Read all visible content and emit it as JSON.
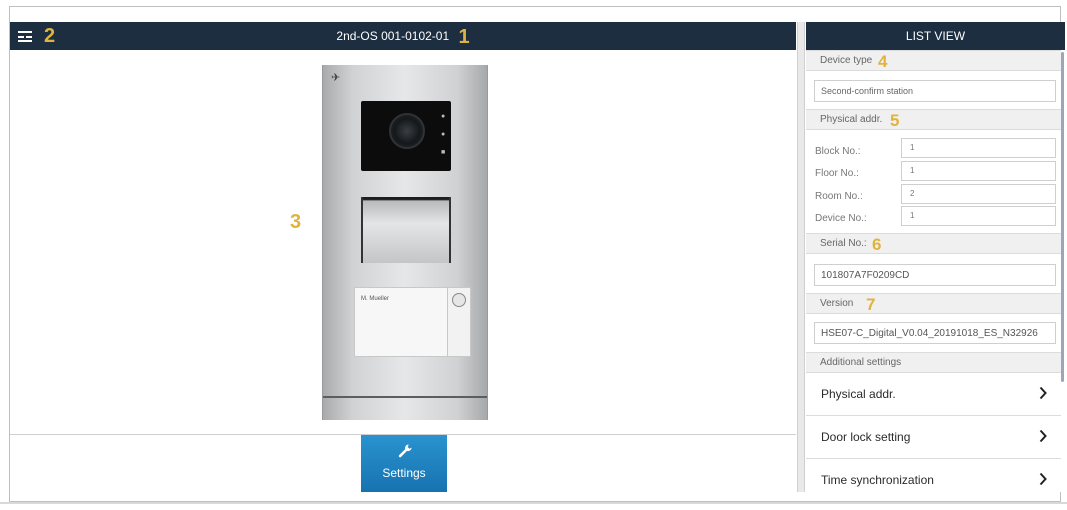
{
  "header": {
    "device_title": "2nd-OS 001-0102-01",
    "list_view_title": "LIST VIEW"
  },
  "callouts": {
    "c1": "1",
    "c2": "2",
    "c3": "3",
    "c4": "4",
    "c5": "5",
    "c6": "6",
    "c7": "7"
  },
  "device_preview": {
    "logo": "✈︎",
    "name_card": "M. Mueller"
  },
  "settings_button": {
    "label": "Settings",
    "icon": "wrench-icon"
  },
  "list": {
    "device_type": {
      "label": "Device type",
      "value": "Second-confirm station"
    },
    "physical_addr": {
      "label": "Physical addr.",
      "rows": [
        {
          "label": "Block No.:",
          "value": "1"
        },
        {
          "label": "Floor No.:",
          "value": "1"
        },
        {
          "label": "Room No.:",
          "value": "2"
        },
        {
          "label": "Device No.:",
          "value": "1"
        }
      ]
    },
    "serial": {
      "label": "Serial No.:",
      "value": "101807A7F0209CD"
    },
    "version": {
      "label": "Version",
      "value": "HSE07-C_Digital_V0.04_20191018_ES_N32926"
    },
    "additional": {
      "label": "Additional settings"
    },
    "nav_items": [
      {
        "label": "Physical addr.",
        "icon": "chevron-right-icon"
      },
      {
        "label": "Door lock setting",
        "icon": "chevron-right-icon"
      },
      {
        "label": "Time synchronization",
        "icon": "chevron-right-icon"
      }
    ]
  },
  "colors": {
    "header_bg": "#1c2e40",
    "accent_blue": "#1f82c0",
    "callout": "#e0b43c"
  }
}
